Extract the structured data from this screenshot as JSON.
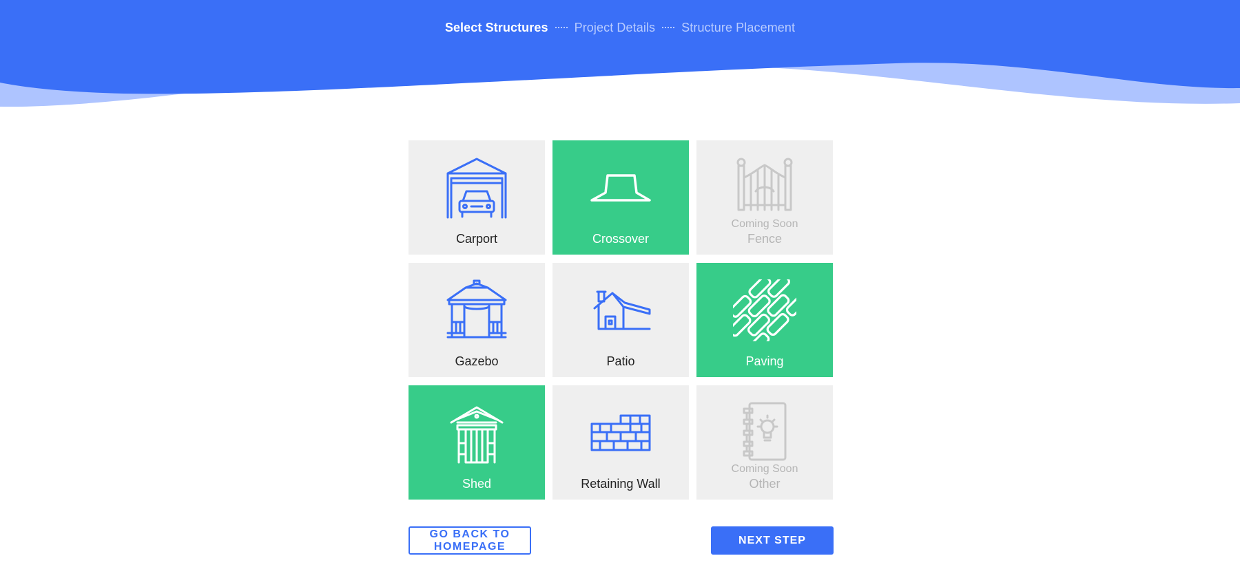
{
  "colors": {
    "header_blue": "#3a6ff7",
    "header_wave_light": "#aec4ff",
    "selected_green": "#37cc89",
    "tile_gray": "#efefef",
    "icon_blue": "#3a6ff7",
    "disabled_gray": "#c8c8c8"
  },
  "stepper": {
    "steps": [
      {
        "label": "Select Structures",
        "active": true
      },
      {
        "label": "Project Details",
        "active": false
      },
      {
        "label": "Structure Placement",
        "active": false
      }
    ]
  },
  "tiles": [
    {
      "label": "Carport",
      "icon": "carport-icon",
      "selected": false,
      "disabled": false
    },
    {
      "label": "Crossover",
      "icon": "crossover-icon",
      "selected": true,
      "disabled": false
    },
    {
      "label": "Fence",
      "icon": "fence-gate-icon",
      "selected": false,
      "disabled": true,
      "badge": "Coming Soon"
    },
    {
      "label": "Gazebo",
      "icon": "gazebo-icon",
      "selected": false,
      "disabled": false
    },
    {
      "label": "Patio",
      "icon": "patio-house-icon",
      "selected": false,
      "disabled": false
    },
    {
      "label": "Paving",
      "icon": "paving-icon",
      "selected": true,
      "disabled": false
    },
    {
      "label": "Shed",
      "icon": "shed-icon",
      "selected": true,
      "disabled": false
    },
    {
      "label": "Retaining Wall",
      "icon": "brick-wall-icon",
      "selected": false,
      "disabled": false
    },
    {
      "label": "Other",
      "icon": "idea-notebook-icon",
      "selected": false,
      "disabled": true,
      "badge": "Coming Soon"
    }
  ],
  "actions": {
    "back_label": "GO BACK TO HOMEPAGE",
    "next_label": "NEXT STEP"
  }
}
